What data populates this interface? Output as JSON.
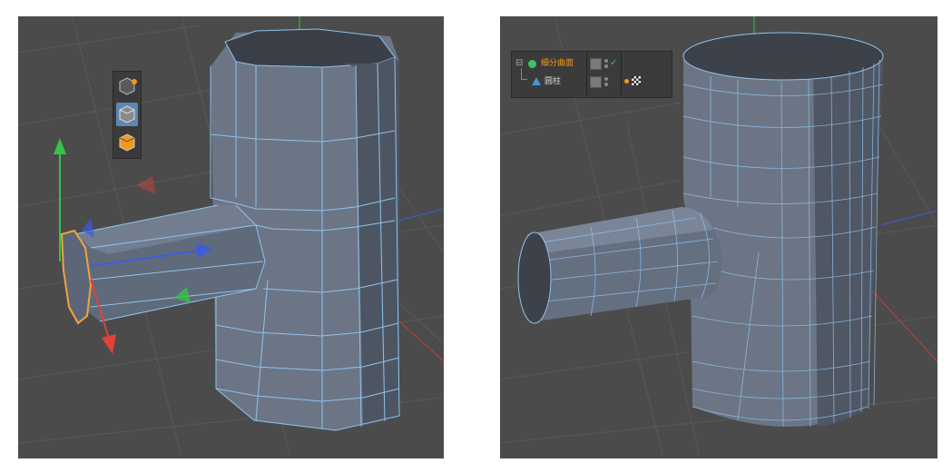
{
  "left_viewport": {
    "mode_buttons": [
      "points-mode",
      "model-mode",
      "polygons-mode"
    ],
    "active_mode": "model-mode"
  },
  "right_viewport": {
    "object_manager": {
      "objects": [
        {
          "name": "细分曲面",
          "icon": "subdivision-surface-icon",
          "selected": true
        },
        {
          "name": "圆柱",
          "icon": "cylinder-icon",
          "selected": false
        }
      ]
    }
  },
  "colors": {
    "viewport_bg": "#4b4b4b",
    "mesh_fill": "#6b7585",
    "wire": "#8fc3ef",
    "selection": "#f0a43a",
    "axis_x": "#e2413b",
    "axis_y": "#36c24a",
    "axis_z": "#3a5de0"
  }
}
